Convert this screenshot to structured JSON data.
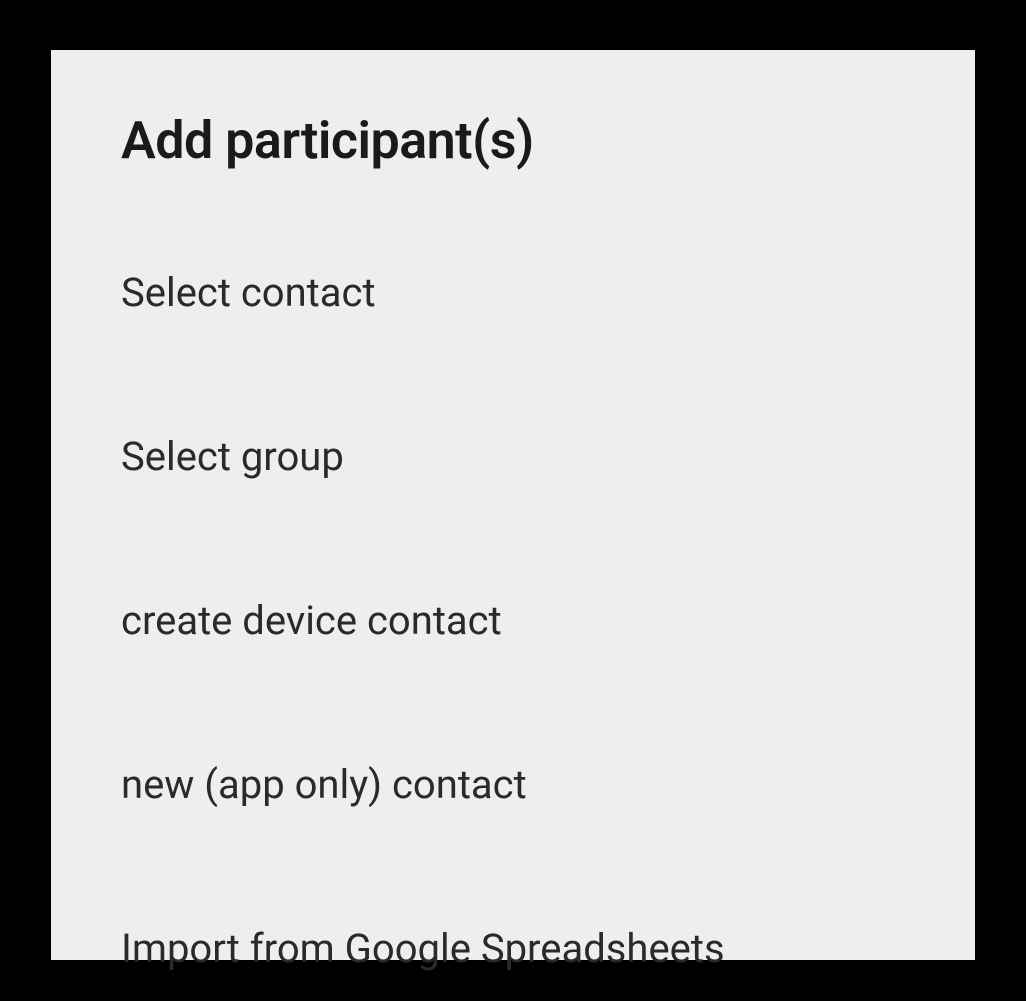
{
  "dialog": {
    "title": "Add participant(s)",
    "options": [
      {
        "label": "Select contact"
      },
      {
        "label": "Select group"
      },
      {
        "label": "create device contact"
      },
      {
        "label": "new (app only) contact"
      },
      {
        "label": "Import from Google Spreadsheets"
      }
    ]
  }
}
